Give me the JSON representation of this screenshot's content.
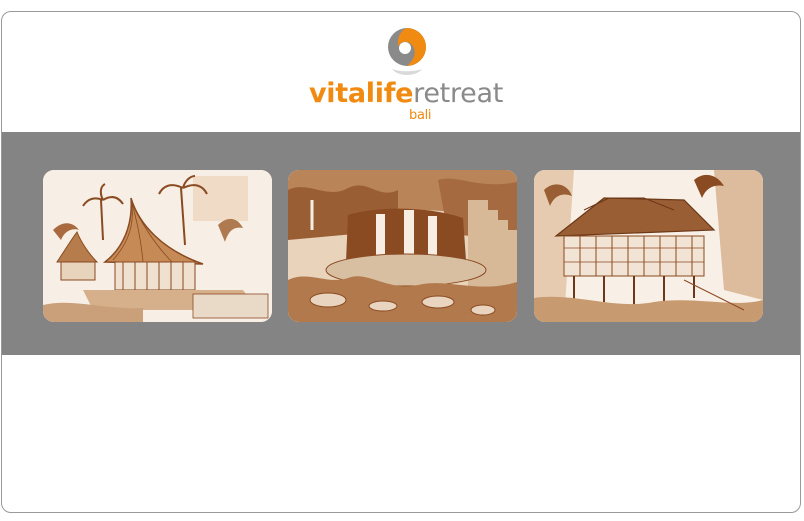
{
  "brand": {
    "name_primary": "vitalife",
    "name_secondary": "retreat",
    "location": "bali",
    "colors": {
      "accent": "#f08a10",
      "secondary_text": "#8a8a8a",
      "band": "#848484",
      "sepia": "#8a4a22"
    },
    "logo_icon": "swirl-logo-icon"
  },
  "gallery": {
    "images": [
      {
        "subject": "thatched-pavilion-sketch"
      },
      {
        "subject": "waterfall-garden-sketch"
      },
      {
        "subject": "stilt-house-sketch"
      }
    ]
  }
}
